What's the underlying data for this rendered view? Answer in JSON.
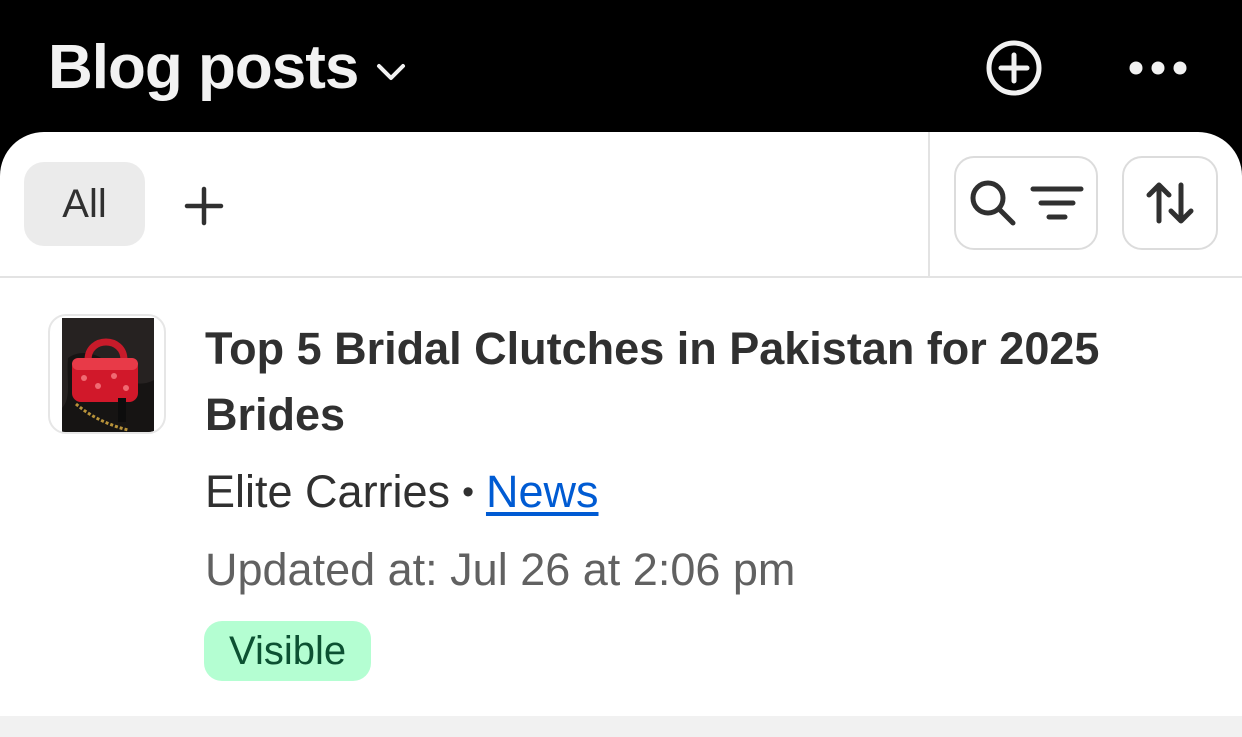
{
  "header": {
    "title": "Blog posts",
    "icons": {
      "title_dropdown": "chevron-down-icon",
      "add": "plus-circle-icon",
      "more": "more-horizontal-icon"
    }
  },
  "toolbar": {
    "tabs": [
      {
        "label": "All",
        "selected": true
      }
    ],
    "icons": {
      "add_view": "plus-icon",
      "search": "search-icon",
      "filter": "filter-icon",
      "sort": "sort-icon"
    }
  },
  "posts": [
    {
      "title": "Top 5 Bridal Clutches in Pakistan for 2025 Brides",
      "author": "Elite Carries",
      "separator": "•",
      "blog": "News",
      "updated": "Updated at: Jul 26 at 2:06 pm",
      "status": "Visible"
    }
  ],
  "colors": {
    "header_bg": "#000000",
    "card_bg": "#ffffff",
    "link": "#005bd3",
    "badge_bg": "#b4fed2",
    "badge_text": "#0c5132",
    "text_primary": "#303030",
    "text_secondary": "#616161"
  }
}
